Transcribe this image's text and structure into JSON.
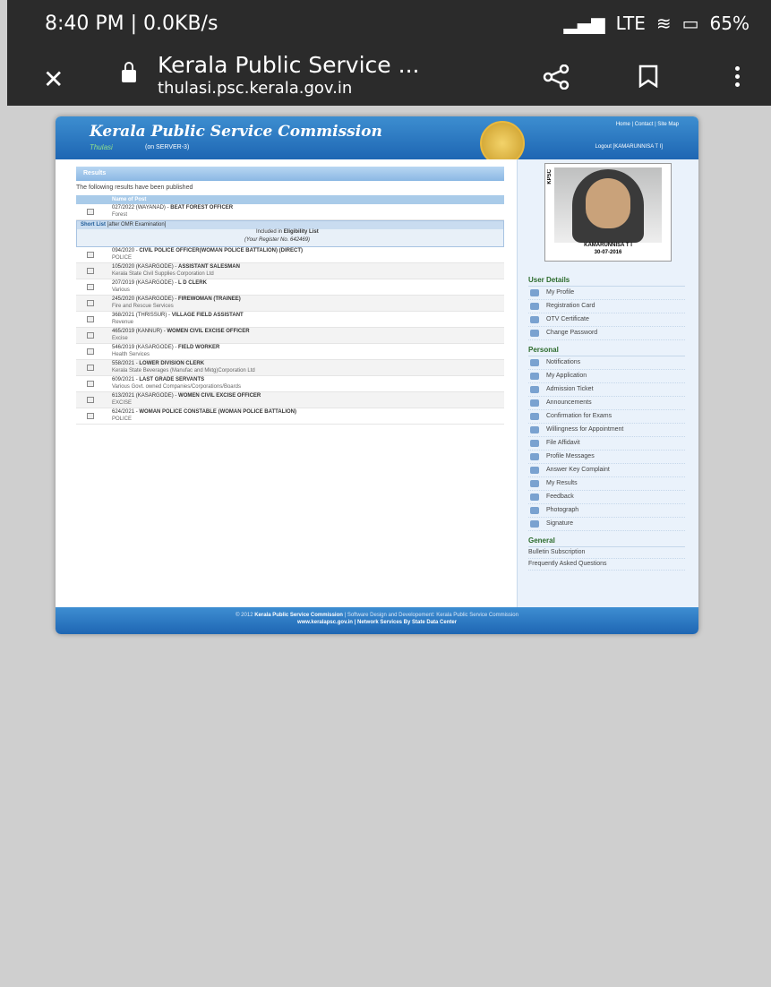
{
  "status_bar": {
    "left_text": "8:40 PM | 0.0KB/s",
    "network": "LTE",
    "battery": "65%"
  },
  "browser": {
    "title": "Kerala Public Service ...",
    "url": "thulasi.psc.kerala.gov.in"
  },
  "site": {
    "brand": "Kerala Public Service Commission",
    "logo_text": "Thulasi",
    "server": "(on SERVER-3)",
    "top_links": "Home | Contact | Site Map",
    "logout": "Logout [KAMARUNNISA T I]"
  },
  "results": {
    "header": "Results",
    "intro": "The following results have been published",
    "column": "Name of Post",
    "first": {
      "title": "027/2022 (WAYANAD) - ",
      "bold": "BEAT FOREST OFFICER",
      "dept": "Forest"
    },
    "shortlist": {
      "label": "Short List",
      "note": "[after OMR Examination]",
      "included": "Included in ",
      "included_bold": "Eligibility List",
      "register": "(Your Register No. 642469)"
    },
    "rows": [
      {
        "title": "094/2020 - ",
        "bold": "CIVIL POLICE OFFICER(WOMAN POLICE BATTALION) (DIRECT)",
        "dept": "POLICE"
      },
      {
        "title": "105/2020 (KASARGODE) - ",
        "bold": "ASSISTANT SALESMAN",
        "dept": "Kerala State Civil Supplies Corporation Ltd"
      },
      {
        "title": "207/2019 (KASARGODE) - ",
        "bold": "L D CLERK",
        "dept": "Various"
      },
      {
        "title": "245/2020 (KASARGODE) - ",
        "bold": "FIREWOMAN (TRAINEE)",
        "dept": "Fire and Rescue Services"
      },
      {
        "title": "368/2021 (THRISSUR) - ",
        "bold": "VILLAGE FIELD ASSISTANT",
        "dept": "Revenue"
      },
      {
        "title": "465/2019 (KANNUR) - ",
        "bold": "WOMEN CIVIL EXCISE OFFICER",
        "dept": "Excise"
      },
      {
        "title": "546/2019 (KASARGODE) - ",
        "bold": "FIELD WORKER",
        "dept": "Health Services"
      },
      {
        "title": "558/2021 - ",
        "bold": "LOWER DIVISION CLERK",
        "dept": "Kerala State Beverages (Manufac and Mktg)Corporation Ltd"
      },
      {
        "title": "609/2021 - ",
        "bold": "LAST GRADE SERVANTS",
        "dept": "Various Govt. owned Companies/Corporations/Boards"
      },
      {
        "title": "613/2021 (KASARGODE) - ",
        "bold": "WOMEN CIVIL EXCISE OFFICER",
        "dept": "EXCISE"
      },
      {
        "title": "624/2021 - ",
        "bold": "WOMAN POLICE CONSTABLE (WOMAN POLICE BATTALION)",
        "dept": "POLICE"
      }
    ]
  },
  "profile": {
    "name": "KAMARUNNISA T I",
    "date": "30-07-2016",
    "stamp": "KPSC"
  },
  "menu": {
    "user_details": "User Details",
    "user_items": [
      "My Profile",
      "Registration Card",
      "OTV Certificate",
      "Change Password"
    ],
    "personal": "Personal",
    "personal_items": [
      "Notifications",
      "My Application",
      "Admission Ticket",
      "Announcements",
      "Confirmation for Exams",
      "Willingness for Appointment",
      "File Affidavit",
      "Profile Messages",
      "Answer Key Complaint",
      "My Results",
      "Feedback",
      "Photograph",
      "Signature"
    ],
    "general": "General",
    "general_items": [
      "Bulletin Subscription",
      "Frequently Asked Questions"
    ]
  },
  "footer": {
    "line1_prefix": "© 2012 ",
    "line1_bold": "Kerala Public Service Commission",
    "line1_rest": " | Software Design and Developement: Kerala Public Service Commission",
    "line2": "www.keralapsc.gov.in | Network Services By State Data Center"
  }
}
